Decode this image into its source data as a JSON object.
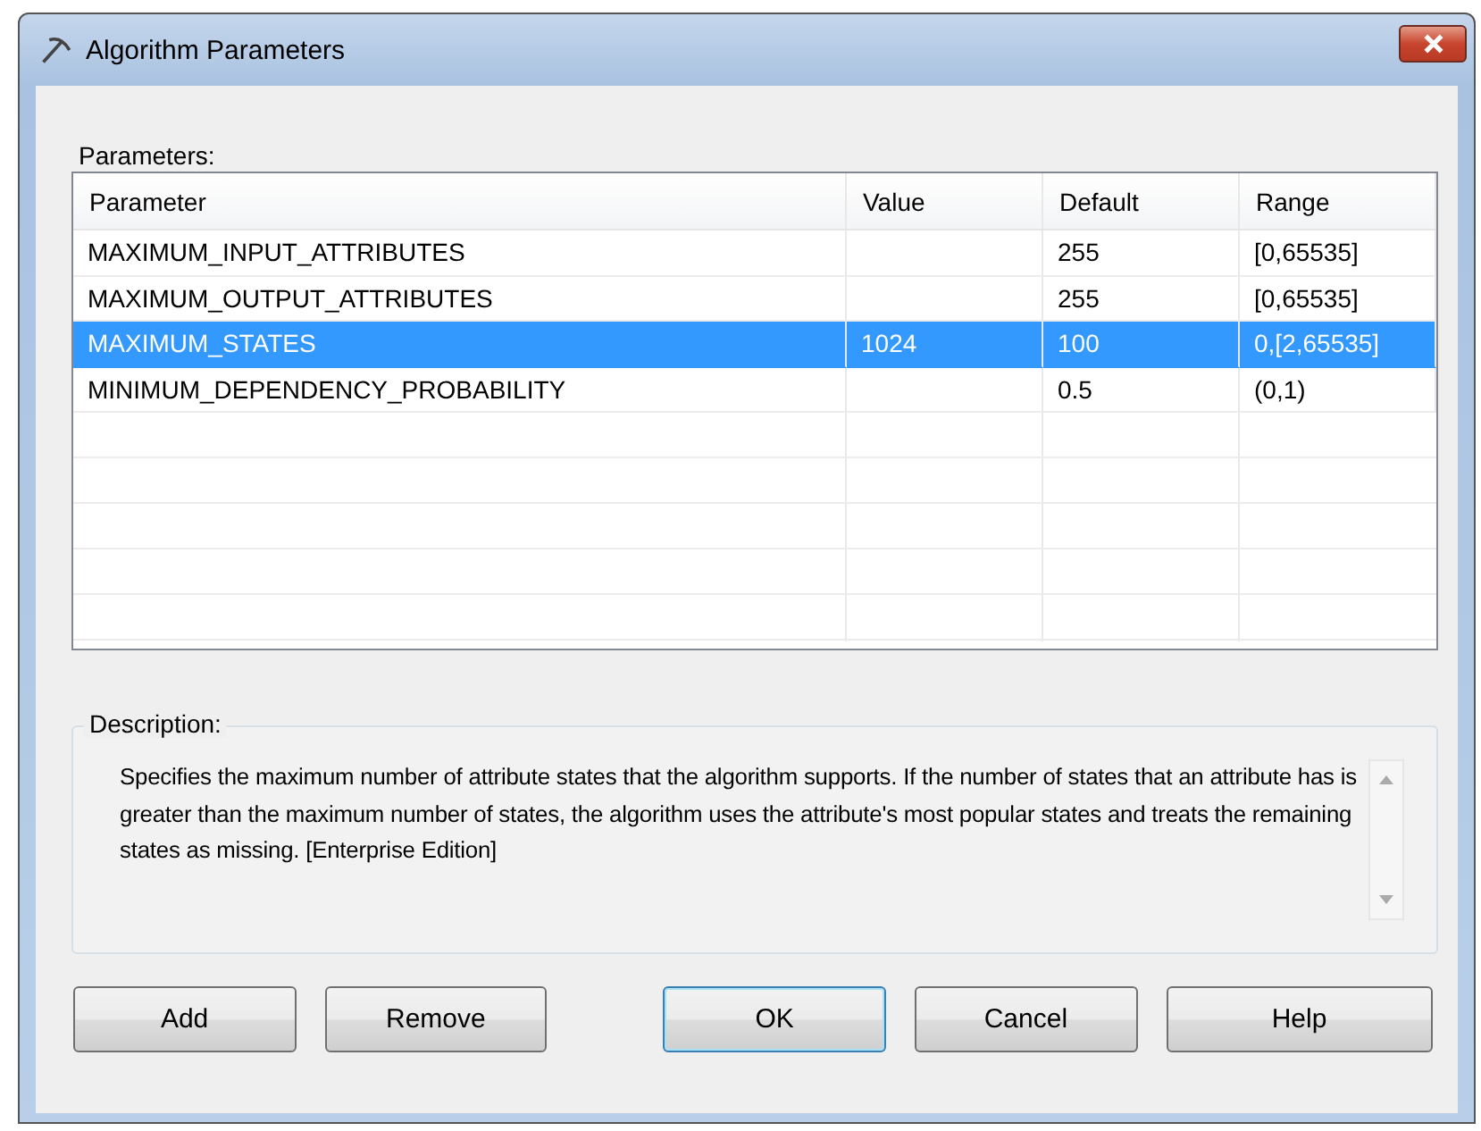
{
  "window": {
    "title": "Algorithm Parameters"
  },
  "parameters_label": "Parameters:",
  "table": {
    "columns": [
      "Parameter",
      "Value",
      "Default",
      "Range"
    ],
    "rows": [
      {
        "cells": [
          "MAXIMUM_INPUT_ATTRIBUTES",
          "",
          "255",
          "[0,65535]"
        ],
        "selected": false
      },
      {
        "cells": [
          "MAXIMUM_OUTPUT_ATTRIBUTES",
          "",
          "255",
          "[0,65535]"
        ],
        "selected": false
      },
      {
        "cells": [
          "MAXIMUM_STATES",
          "1024",
          "100",
          "0,[2,65535]"
        ],
        "selected": true
      },
      {
        "cells": [
          "MINIMUM_DEPENDENCY_PROBABILITY",
          "",
          "0.5",
          "(0,1)"
        ],
        "selected": false
      }
    ]
  },
  "description": {
    "label": "Description:",
    "text": "Specifies the maximum number of attribute states that the algorithm supports. If the number of states that an attribute has is greater than the maximum number of states, the algorithm uses the attribute's most popular states and treats the remaining states as missing. [Enterprise Edition]"
  },
  "buttons": [
    {
      "label": "Add",
      "default": false
    },
    {
      "label": "Remove",
      "default": false
    },
    {
      "label": "OK",
      "default": true
    },
    {
      "label": "Cancel",
      "default": false
    },
    {
      "label": "Help",
      "default": false
    }
  ]
}
